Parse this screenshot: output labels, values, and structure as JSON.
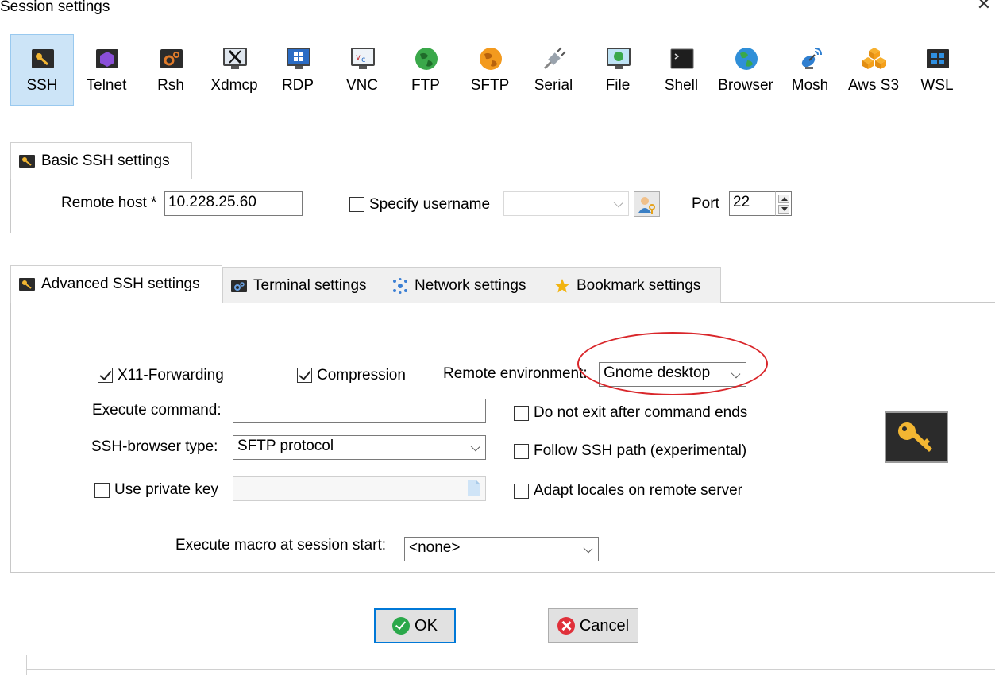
{
  "window": {
    "title": "Session settings",
    "close_glyph": "✕"
  },
  "session_types": [
    {
      "label": "SSH",
      "icon": "ssh-key-icon",
      "active": true
    },
    {
      "label": "Telnet",
      "icon": "telnet-icon"
    },
    {
      "label": "Rsh",
      "icon": "rsh-icon"
    },
    {
      "label": "Xdmcp",
      "icon": "xdmcp-icon"
    },
    {
      "label": "RDP",
      "icon": "rdp-icon"
    },
    {
      "label": "VNC",
      "icon": "vnc-icon"
    },
    {
      "label": "FTP",
      "icon": "ftp-globe-icon"
    },
    {
      "label": "SFTP",
      "icon": "sftp-globe-icon"
    },
    {
      "label": "Serial",
      "icon": "serial-plug-icon"
    },
    {
      "label": "File",
      "icon": "file-monitor-icon"
    },
    {
      "label": "Shell",
      "icon": "shell-terminal-icon"
    },
    {
      "label": "Browser",
      "icon": "browser-globe-icon"
    },
    {
      "label": "Mosh",
      "icon": "mosh-satellite-icon"
    },
    {
      "label": "Aws S3",
      "icon": "aws-s3-cubes-icon"
    },
    {
      "label": "WSL",
      "icon": "wsl-windows-icon"
    }
  ],
  "basic": {
    "tab_label": "Basic SSH settings",
    "remote_host_label": "Remote host *",
    "remote_host_value": "10.228.25.60",
    "specify_username_label": "Specify username",
    "username_value": "",
    "port_label": "Port",
    "port_value": "22"
  },
  "advanced_tabs": [
    {
      "label": "Advanced SSH settings",
      "icon": "key-icon",
      "active": true
    },
    {
      "label": "Terminal settings",
      "icon": "terminal-icon"
    },
    {
      "label": "Network settings",
      "icon": "network-icon"
    },
    {
      "label": "Bookmark settings",
      "icon": "star-icon"
    }
  ],
  "advanced": {
    "x11_label": "X11-Forwarding",
    "x11_checked": true,
    "compression_label": "Compression",
    "compression_checked": true,
    "remote_env_label": "Remote environment:",
    "remote_env_value": "Gnome desktop",
    "execute_command_label": "Execute command:",
    "execute_command_value": "",
    "ssh_browser_label": "SSH-browser type:",
    "ssh_browser_value": "SFTP protocol",
    "private_key_label": "Use private key",
    "no_exit_label": "Do not exit after command ends",
    "follow_path_label": "Follow SSH path (experimental)",
    "adapt_locales_label": "Adapt locales on remote server",
    "macro_label": "Execute macro at session start:",
    "macro_value": "<none>"
  },
  "buttons": {
    "ok": "OK",
    "cancel": "Cancel"
  },
  "colors": {
    "active_tab_bg": "#cce4f7",
    "highlight_ellipse": "#d9262a",
    "ok_green": "#2aa84a",
    "cancel_red": "#e0303a"
  }
}
